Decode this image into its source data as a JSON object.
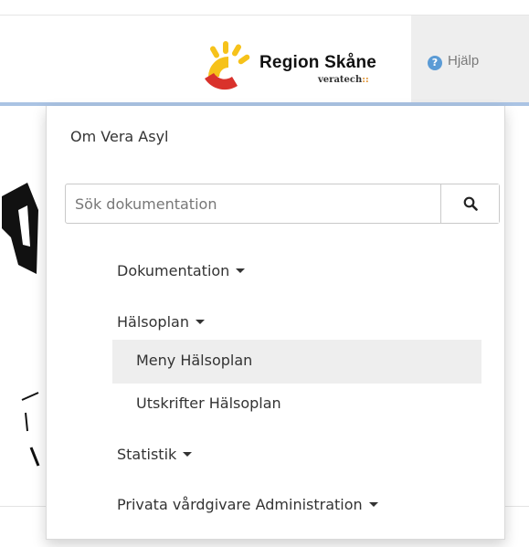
{
  "header": {
    "logo": {
      "title": "Region Skåne",
      "subtitle": "veratech",
      "subtitle_dots": "::"
    },
    "help": {
      "icon": "question-circle-icon",
      "label": "Hjälp"
    }
  },
  "dropdown": {
    "about_label": "Om Vera Asyl",
    "search": {
      "placeholder": "Sök dokumentation",
      "value": "",
      "button_icon": "search-icon"
    },
    "sections": [
      {
        "label": "Dokumentation"
      },
      {
        "label": "Hälsoplan",
        "items": [
          "Meny Hälsoplan",
          "Utskrifter Hälsoplan"
        ]
      },
      {
        "label": "Statistik"
      },
      {
        "label": "Privata vårdgivare Administration"
      }
    ]
  },
  "colors": {
    "accent_blue": "#5b9bd5",
    "logo_yellow": "#f6c21a",
    "logo_red": "#d9322c",
    "hover_bg": "#eeeeee"
  }
}
